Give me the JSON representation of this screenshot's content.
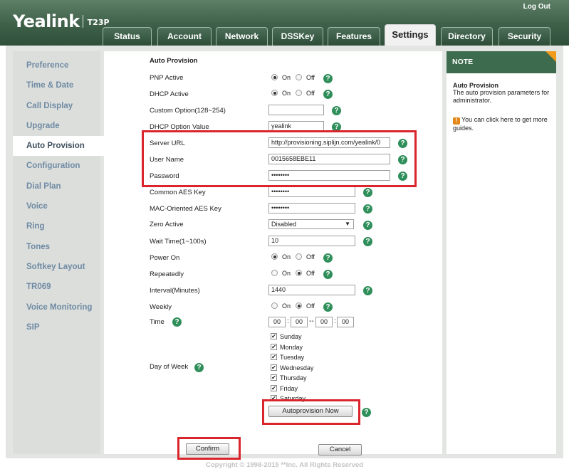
{
  "header": {
    "logo": "Yealink",
    "model": "T23P",
    "logout": "Log Out",
    "tabs": [
      "Status",
      "Account",
      "Network",
      "DSSKey",
      "Features",
      "Settings",
      "Directory",
      "Security"
    ],
    "active_tab": "Settings"
  },
  "sidebar": {
    "items": [
      "Preference",
      "Time & Date",
      "Call Display",
      "Upgrade",
      "Auto Provision",
      "Configuration",
      "Dial Plan",
      "Voice",
      "Ring",
      "Tones",
      "Softkey Layout",
      "TR069",
      "Voice Monitoring",
      "SIP"
    ],
    "active": "Auto Provision"
  },
  "form": {
    "section_title": "Auto Provision",
    "pnp_active": {
      "label": "PNP Active",
      "on": "On",
      "off": "Off",
      "value": "On"
    },
    "dhcp_active": {
      "label": "DHCP Active",
      "on": "On",
      "off": "Off",
      "value": "On"
    },
    "custom_option": {
      "label": "Custom Option(128~254)",
      "value": ""
    },
    "dhcp_option_value": {
      "label": "DHCP Option Value",
      "value": "yealink"
    },
    "server_url": {
      "label": "Server URL",
      "value": "http://provisioning.siplijn.com/yealink/0"
    },
    "user_name": {
      "label": "User Name",
      "value": "0015658EBE11"
    },
    "password": {
      "label": "Password",
      "value": "••••••••"
    },
    "common_aes_key": {
      "label": "Common AES Key",
      "value": "••••••••"
    },
    "mac_aes_key": {
      "label": "MAC-Oriented AES Key",
      "value": "••••••••"
    },
    "zero_active": {
      "label": "Zero Active",
      "value": "Disabled"
    },
    "wait_time": {
      "label": "Wait Time(1~100s)",
      "value": "10"
    },
    "power_on": {
      "label": "Power On",
      "on": "On",
      "off": "Off",
      "value": "On"
    },
    "repeatedly": {
      "label": "Repeatedly",
      "on": "On",
      "off": "Off",
      "value": "Off"
    },
    "interval": {
      "label": "Interval(Minutes)",
      "value": "1440"
    },
    "weekly": {
      "label": "Weekly",
      "on": "On",
      "off": "Off",
      "value": "Off"
    },
    "time": {
      "label": "Time",
      "start_h": "00",
      "start_m": "00",
      "end_h": "00",
      "end_m": "00",
      "sep": "--"
    },
    "day_of_week": {
      "label": "Day of Week",
      "days": [
        "Sunday",
        "Monday",
        "Tuesday",
        "Wednesday",
        "Thursday",
        "Friday",
        "Saturday"
      ]
    },
    "autoprovision_button": "Autoprovision Now",
    "confirm_button": "Confirm",
    "cancel_button": "Cancel"
  },
  "note": {
    "heading": "NOTE",
    "title": "Auto Provision",
    "text": "The auto provision parameters for administrator.",
    "guide": "You can click here to get more guides."
  },
  "footer": {
    "copyright": "Copyright © 1998-2015 **Inc. All Rights Reserved"
  },
  "colors": {
    "header_green": "#3e6049",
    "help_green": "#2f8f5a",
    "highlight_red": "#d9252b",
    "note_orange": "#f29a1c"
  }
}
